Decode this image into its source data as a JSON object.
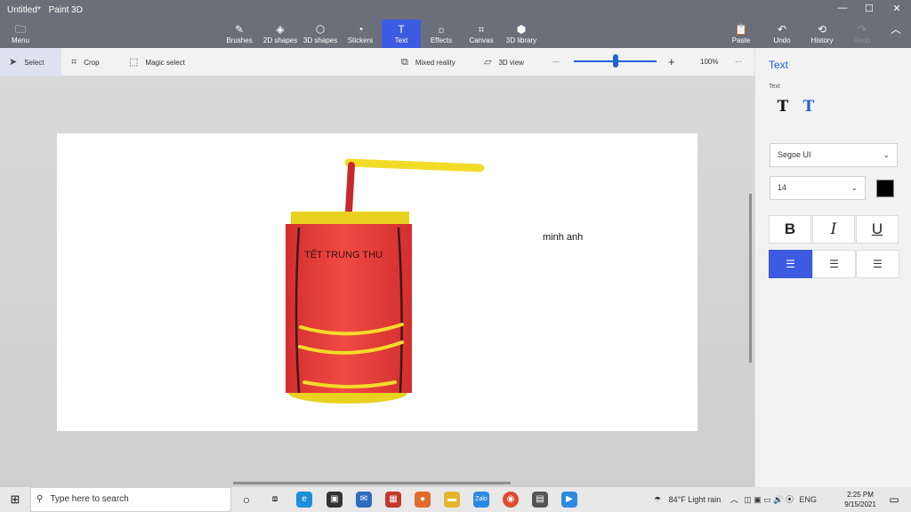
{
  "window": {
    "doc_title": "Untitled*",
    "app_name": "Paint 3D",
    "minimize": "—",
    "maximize": "☐",
    "close": "✕"
  },
  "ribbon": {
    "menu": "Menu",
    "brushes": "Brushes",
    "shapes2d": "2D shapes",
    "shapes3d": "3D shapes",
    "stickers": "Stickers",
    "text": "Text",
    "effects": "Effects",
    "canvas": "Canvas",
    "library3d": "3D library",
    "paste": "Paste",
    "undo": "Undo",
    "history": "History",
    "redo": "Redo"
  },
  "toolbar": {
    "select": "Select",
    "crop": "Crop",
    "magic_select": "Magic select",
    "mixed_reality": "Mixed reality",
    "view3d": "3D view",
    "zoom_minus": "—",
    "zoom_plus": "+",
    "zoom_level": "100%",
    "more": "···"
  },
  "canvas": {
    "lantern_text": "TẾT TRUNG THU",
    "name_text": "minh anh",
    "colors": {
      "body": "#d32f2f",
      "body_light": "#f04a43",
      "trim": "#e8d21f",
      "stick": "#f2dc2a",
      "hanger": "#c9282b"
    }
  },
  "panel": {
    "title": "Text",
    "subtitle": "Text",
    "font": "Segoe UI",
    "size": "14",
    "bold": "B",
    "italic": "I",
    "underline": "U",
    "text_color": "#000000"
  },
  "taskbar": {
    "search_placeholder": "Type here to search",
    "weather": "84°F  Light rain",
    "lang": "ENG",
    "time": "2:25 PM",
    "date": "9/15/2021"
  }
}
